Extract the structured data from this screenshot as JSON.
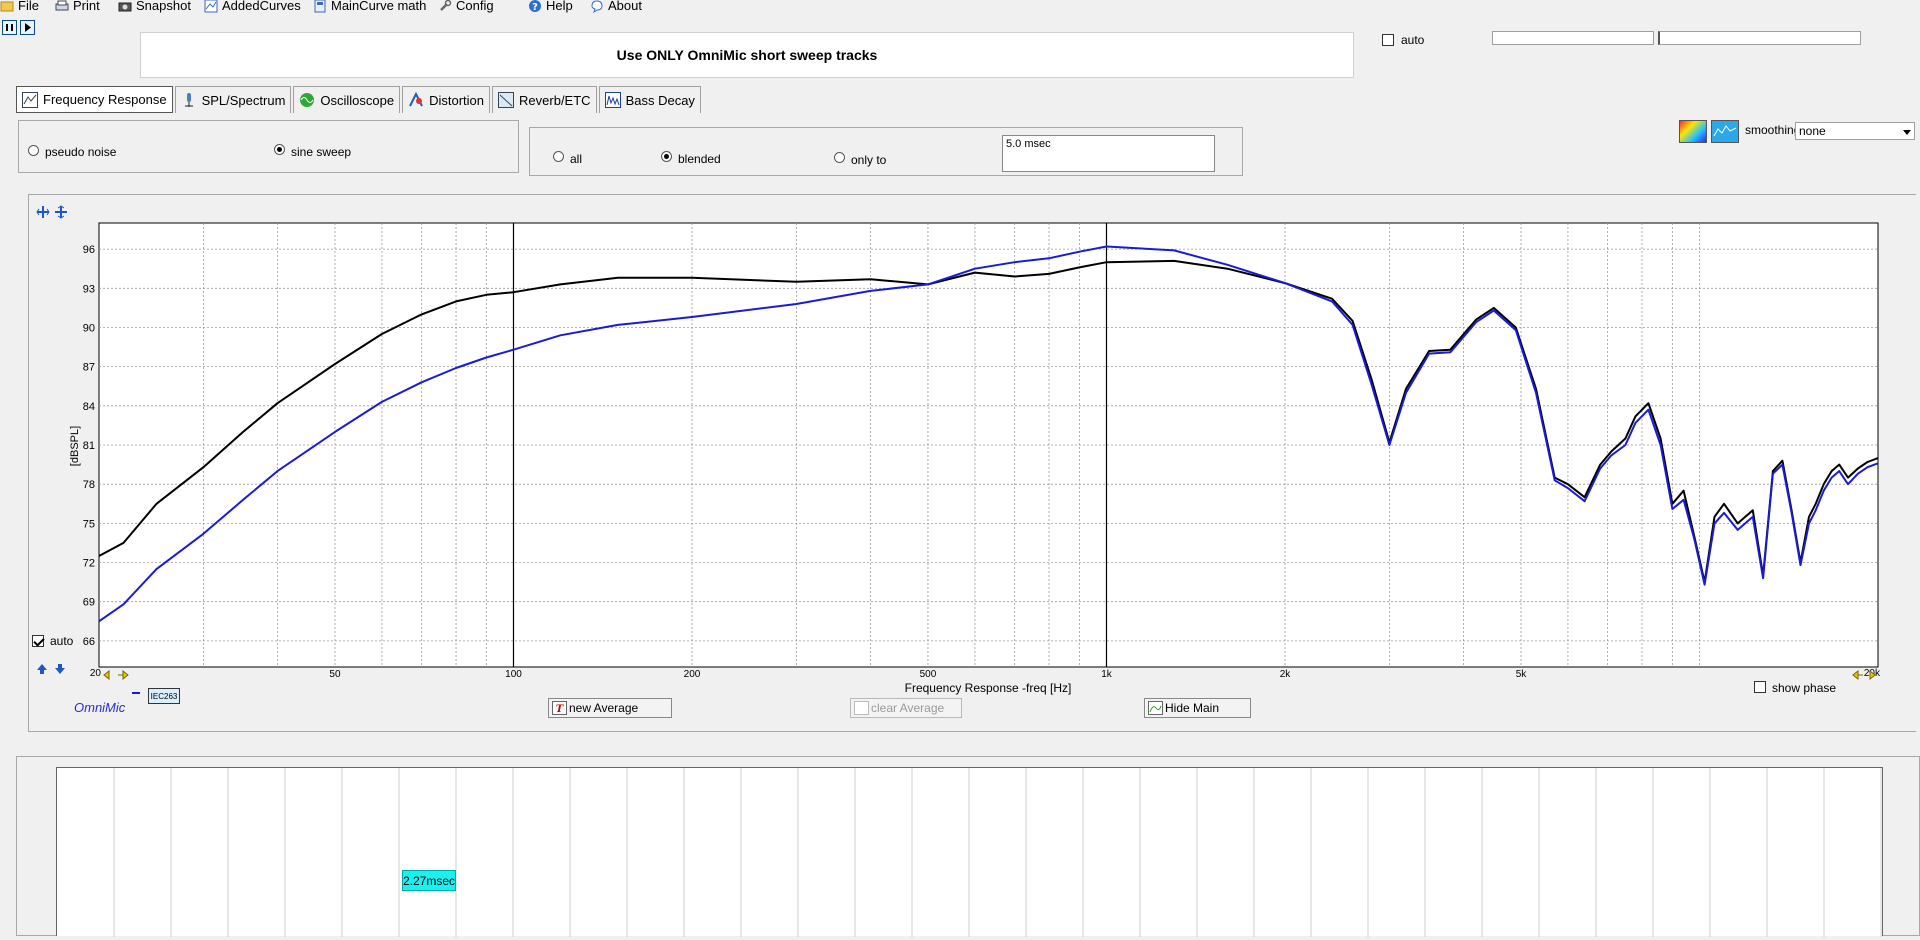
{
  "menu": {
    "file": "File",
    "print": "Print",
    "snapshot": "Snapshot",
    "added_curves": "AddedCurves",
    "maincurve_math": "MainCurve math",
    "config": "Config",
    "help": "Help",
    "about": "About"
  },
  "header": {
    "notice": "Use ONLY OmniMic short sweep tracks",
    "auto_label": "auto"
  },
  "tabs": [
    {
      "label": "Frequency Response"
    },
    {
      "label": "SPL/Spectrum"
    },
    {
      "label": "Oscilloscope"
    },
    {
      "label": "Distortion"
    },
    {
      "label": "Reverb/ETC"
    },
    {
      "label": "Bass Decay"
    }
  ],
  "signal": {
    "pseudo_noise": "pseudo noise",
    "sine_sweep": "sine sweep",
    "selected": "sine sweep"
  },
  "window": {
    "all": "all",
    "blended": "blended",
    "only_to": "only to",
    "selected": "blended",
    "time_value": "5.0 msec"
  },
  "smoothing": {
    "label": "smoothing",
    "value": "none"
  },
  "plot": {
    "auto_label": "auto",
    "show_phase": "show phase",
    "omnimic": "OmniMic",
    "iec_badge": "IEC263",
    "x_first_tick": "20",
    "x_last_tick": "20k"
  },
  "buttons": {
    "new_average": "new Average",
    "clear_average": "clear Average",
    "hide_main": "Hide Main"
  },
  "bottom": {
    "time_marker": "2.27msec"
  },
  "colors": {
    "blue_curve": "#1a1ad8",
    "black_curve": "#000000",
    "cyan_tag": "#19f0f0"
  },
  "chart_data": {
    "type": "line",
    "xscale": "log",
    "xlim": [
      20,
      20000
    ],
    "ylim": [
      64,
      98
    ],
    "xlabel": "Frequency Response -freq [Hz]",
    "ylabel": "[dBSPL]",
    "grid": true,
    "xticks": [
      {
        "value": 50,
        "label": "50"
      },
      {
        "value": 100,
        "label": "100"
      },
      {
        "value": 200,
        "label": "200"
      },
      {
        "value": 500,
        "label": "500"
      },
      {
        "value": 1000,
        "label": "1k"
      },
      {
        "value": 2000,
        "label": "2k"
      },
      {
        "value": 5000,
        "label": "5k"
      }
    ],
    "yticks": [
      96,
      93,
      90,
      87,
      84,
      81,
      78,
      75,
      72,
      69,
      66
    ],
    "series": [
      {
        "color": "#000000",
        "x": [
          20,
          22,
          25,
          30,
          35,
          40,
          50,
          60,
          70,
          80,
          90,
          100,
          120,
          150,
          200,
          300,
          400,
          500,
          600,
          700,
          800,
          900,
          1000,
          1300,
          1600,
          2000,
          2400,
          2600,
          2800,
          3000,
          3200,
          3500,
          3800,
          4200,
          4500,
          4900,
          5300,
          5700,
          6000,
          6400,
          6800,
          7100,
          7500,
          7800,
          8200,
          8600,
          9000,
          9400,
          9800,
          10200,
          10600,
          11000,
          11600,
          12300,
          12800,
          13300,
          13800,
          14300,
          14800,
          15300,
          15700,
          16200,
          16700,
          17200,
          17800,
          18500,
          19200,
          20000
        ],
        "y": [
          72.5,
          73.5,
          76.5,
          79.3,
          82.0,
          84.2,
          87.2,
          89.5,
          91.0,
          92.0,
          92.5,
          92.7,
          93.3,
          93.8,
          93.8,
          93.5,
          93.7,
          93.3,
          94.2,
          93.9,
          94.1,
          94.6,
          95.0,
          95.1,
          94.5,
          93.4,
          92.2,
          90.5,
          86.0,
          81.2,
          85.3,
          88.2,
          88.3,
          90.6,
          91.5,
          90.0,
          85.3,
          78.5,
          78.0,
          77.0,
          79.5,
          80.5,
          81.5,
          83.2,
          84.2,
          81.5,
          76.5,
          77.5,
          74.0,
          70.5,
          75.5,
          76.5,
          75.0,
          76.0,
          71.0,
          79.0,
          79.8,
          76.0,
          72.0,
          75.5,
          76.5,
          78.0,
          79.0,
          79.5,
          78.5,
          79.2,
          79.7,
          80.0
        ]
      },
      {
        "color": "#1a1ad8",
        "x": [
          20,
          22,
          25,
          30,
          35,
          40,
          50,
          60,
          70,
          80,
          90,
          100,
          120,
          150,
          200,
          300,
          400,
          500,
          600,
          700,
          800,
          900,
          1000,
          1300,
          1600,
          2000,
          2400,
          2600,
          2800,
          3000,
          3200,
          3500,
          3800,
          4200,
          4500,
          4900,
          5300,
          5700,
          6000,
          6400,
          6800,
          7100,
          7500,
          7800,
          8200,
          8600,
          9000,
          9400,
          9800,
          10200,
          10600,
          11000,
          11600,
          12300,
          12800,
          13300,
          13800,
          14300,
          14800,
          15300,
          15700,
          16200,
          16700,
          17200,
          17800,
          18500,
          19200,
          20000
        ],
        "y": [
          67.5,
          68.8,
          71.5,
          74.2,
          76.8,
          79.0,
          82.0,
          84.3,
          85.8,
          86.9,
          87.7,
          88.3,
          89.4,
          90.2,
          90.8,
          91.8,
          92.8,
          93.3,
          94.5,
          95.0,
          95.3,
          95.8,
          96.2,
          95.9,
          94.8,
          93.4,
          92.0,
          90.2,
          85.6,
          81.0,
          85.0,
          88.0,
          88.1,
          90.4,
          91.3,
          89.8,
          85.0,
          78.3,
          77.7,
          76.7,
          79.2,
          80.2,
          81.0,
          82.7,
          83.7,
          81.0,
          76.1,
          76.8,
          73.8,
          70.3,
          75.0,
          75.8,
          74.5,
          75.5,
          70.8,
          78.8,
          79.5,
          75.8,
          71.8,
          75.0,
          76.0,
          77.5,
          78.5,
          79.0,
          78.0,
          78.8,
          79.3,
          79.6
        ]
      }
    ]
  }
}
